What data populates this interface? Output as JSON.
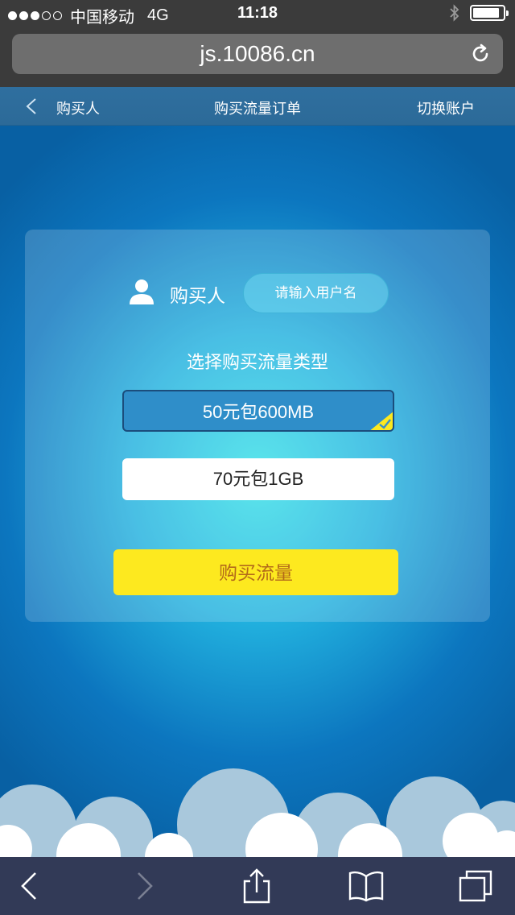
{
  "status_bar": {
    "carrier": "中国移动",
    "network": "4G",
    "time": "11:18",
    "signal_bars": 3,
    "signal_total": 5,
    "battery_level": 0.9
  },
  "browser": {
    "url": "js.10086.cn",
    "reload_icon": "reload-icon"
  },
  "nav": {
    "back_icon": "chevron-left-icon",
    "back_label": "购买人",
    "title": "购买流量订单",
    "right_label": "切换账户"
  },
  "form": {
    "buyer_icon": "user-icon",
    "buyer_label": "购买人",
    "buyer_placeholder": "请输入用户名",
    "section_title": "选择购买流量类型",
    "packages": [
      {
        "label": "50元包600MB",
        "selected": true
      },
      {
        "label": "70元包1GB",
        "selected": false
      }
    ],
    "buy_button": "购买流量"
  },
  "toolbar": {
    "items": [
      "back-icon",
      "forward-icon",
      "share-icon",
      "bookmarks-icon",
      "tabs-icon"
    ]
  },
  "colors": {
    "accent_yellow": "#fde91f",
    "button_text": "#b36a1a",
    "selected_pkg": "#2f8ec9"
  }
}
